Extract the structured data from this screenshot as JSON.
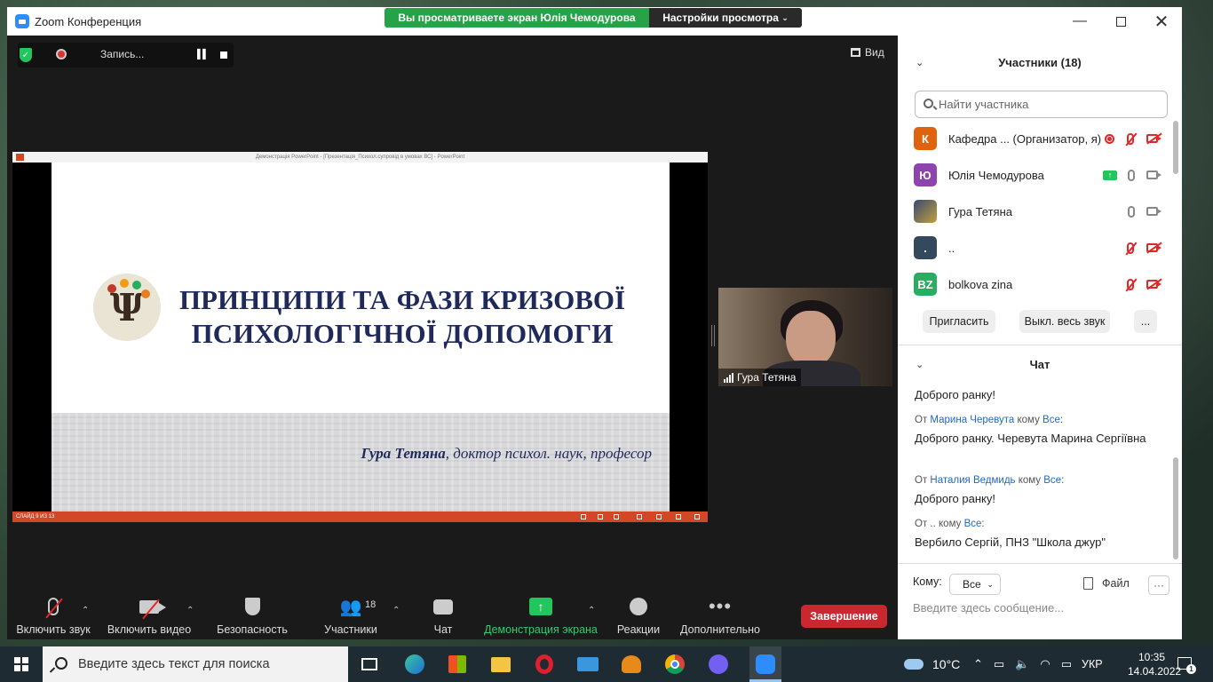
{
  "window": {
    "title": "Zoom Конференция"
  },
  "banner": {
    "sharing_text": "Вы просматриваете экран Юлія Чемодурова",
    "view_options": "Настройки просмотра"
  },
  "recording": {
    "label": "Запись..."
  },
  "view_button": "Вид",
  "presentation": {
    "ppt_title": "Демонстрація PowerPoint - [Презентація_Психол.супровід в умовах ВС] - PowerPoint",
    "slide_title_line1": "ПРИНЦИПИ ТА ФАЗИ КРИЗОВОЇ",
    "slide_title_line2": "ПСИХОЛОГІЧНОЇ ДОПОМОГИ",
    "author_name": "Гура Тетяна",
    "author_rest": ", доктор психол. наук, професор",
    "slide_status": "СЛАЙД 9 ИЗ 13"
  },
  "video_tile": {
    "name": "Гура Тетяна"
  },
  "toolbar": {
    "audio": "Включить звук",
    "video": "Включить видео",
    "security": "Безопасность",
    "participants": "Участники",
    "participants_count": "18",
    "chat": "Чат",
    "share": "Демонстрация экрана",
    "reactions": "Реакции",
    "more": "Дополнительно",
    "end": "Завершение"
  },
  "participants_panel": {
    "header": "Участники (18)",
    "search_placeholder": "Найти участника",
    "list": [
      {
        "initials": "К",
        "name": "Кафедра ... (Организатор, я)",
        "color": "#e0620d"
      },
      {
        "initials": "Ю",
        "name": "Юлія Чемодурова",
        "color": "#8e44ad"
      },
      {
        "initials": "",
        "name": "Гура Тетяна",
        "color": "#4a5a7a"
      },
      {
        "initials": ".",
        "name": "..",
        "color": "#34495e"
      },
      {
        "initials": "BZ",
        "name": "bolkova zina",
        "color": "#27ae60"
      }
    ],
    "invite": "Пригласить",
    "mute_all": "Выкл. весь звук",
    "more": "..."
  },
  "chat_panel": {
    "header": "Чат",
    "messages": [
      {
        "from": "",
        "to": "",
        "text": "Доброго ранку!"
      },
      {
        "from": "Марина Черевута",
        "to": "Все",
        "text": "Доброго ранку. Черевута Марина Сергіївна"
      },
      {
        "from": "Наталия Ведмидь",
        "to": "Все",
        "text": "Доброго ранку!"
      },
      {
        "from": "..",
        "to": "Все",
        "text": "Вербило Сергій, ПНЗ \"Школа джур\""
      }
    ],
    "prefix_from": "От",
    "prefix_to": "кому",
    "to_label": "Кому:",
    "to_value": "Все",
    "file": "Файл",
    "input_placeholder": "Введите здесь сообщение..."
  },
  "taskbar": {
    "search_placeholder": "Введите здесь текст для поиска",
    "weather": "10°C",
    "lang": "УКР",
    "time": "10:35",
    "date": "14.04.2022",
    "notifications": "1"
  }
}
